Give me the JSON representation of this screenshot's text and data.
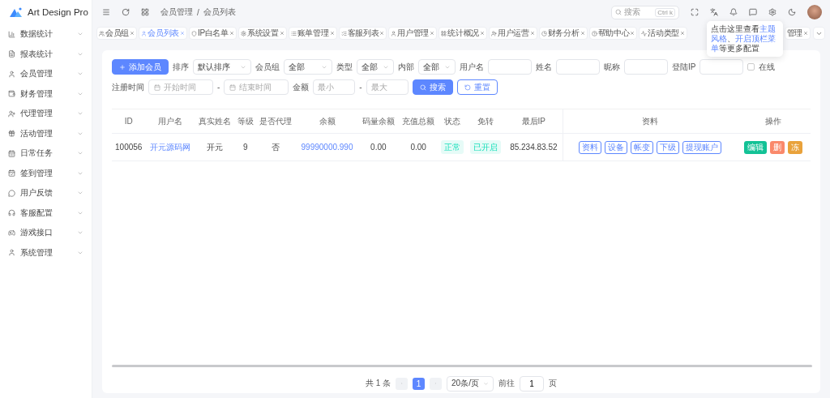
{
  "logo": {
    "title": "Art Design Pro"
  },
  "sidebar": {
    "items": [
      {
        "label": "数据统计"
      },
      {
        "label": "报表统计"
      },
      {
        "label": "会员管理"
      },
      {
        "label": "财务管理"
      },
      {
        "label": "代理管理"
      },
      {
        "label": "活动管理"
      },
      {
        "label": "日常任务"
      },
      {
        "label": "签到管理"
      },
      {
        "label": "用户反馈"
      },
      {
        "label": "客服配置"
      },
      {
        "label": "游戏接口"
      },
      {
        "label": "系统管理"
      }
    ]
  },
  "breadcrumb": {
    "items": [
      "会员管理",
      "会员列表"
    ],
    "separator": "/"
  },
  "search": {
    "placeholder": "搜索",
    "shortcut": "Ctrl k"
  },
  "tabs": [
    {
      "label": "会员组",
      "selected": false
    },
    {
      "label": "会员列表",
      "selected": true
    },
    {
      "label": "IP白名单",
      "selected": false
    },
    {
      "label": "系统设置",
      "selected": false
    },
    {
      "label": "账单管理",
      "selected": false
    },
    {
      "label": "客服列表",
      "selected": false
    },
    {
      "label": "用户管理",
      "selected": false
    },
    {
      "label": "统计概况",
      "selected": false
    },
    {
      "label": "用户运营",
      "selected": false
    },
    {
      "label": "财务分析",
      "selected": false
    },
    {
      "label": "帮助中心",
      "selected": false
    },
    {
      "label": "活动类型",
      "selected": false
    },
    {
      "label": "管理",
      "selected": false
    }
  ],
  "tooltip": {
    "text": "点击这里查看**主题风格**、**开启顶栏菜单**等更多配置"
  },
  "filters": {
    "add_button": "添加会员",
    "row1": [
      {
        "label": "排序",
        "kind": "select",
        "value": "默认排序"
      },
      {
        "label": "会员组",
        "kind": "select",
        "value": "全部"
      },
      {
        "label": "类型",
        "kind": "select",
        "value": "全部"
      },
      {
        "label": "内部",
        "kind": "select",
        "value": "全部"
      },
      {
        "label": "用户名",
        "kind": "input"
      },
      {
        "label": "姓名",
        "kind": "input"
      },
      {
        "label": "昵称",
        "kind": "input"
      },
      {
        "label": "登陆IP",
        "kind": "input"
      }
    ],
    "online": {
      "label": "在线",
      "checked": false
    },
    "register_time": {
      "label": "注册时间",
      "start": "开始时间",
      "dash": "-",
      "end": "结束时间"
    },
    "amount": {
      "label": "金额",
      "min_placeholder": "最小",
      "dash": "-",
      "max_placeholder": "最大"
    },
    "search_button": "搜索",
    "reset_button": "重置"
  },
  "table": {
    "columns": [
      "ID",
      "用户名",
      "真实姓名",
      "等级",
      "是否代理",
      "余额",
      "码量余额",
      "充值总额",
      "状态",
      "免转",
      "最后IP",
      "资料",
      "操作"
    ],
    "rows": [
      {
        "id": "100056",
        "username": "开元源码网",
        "real_name": "开元",
        "level_text": "9",
        "agent": "否",
        "balance": "99990000.990",
        "code_balance": "0.00",
        "recharge_total": "0.00",
        "status": "正常",
        "free_transfer": "已开启",
        "last_ip": "85.234.83.52",
        "data_buttons": [
          "资料",
          "设备",
          "帐变",
          "下级",
          "提现账户"
        ],
        "actions": [
          {
            "label": "编辑",
            "kind": "edit"
          },
          {
            "label": "删",
            "kind": "delete"
          },
          {
            "label": "冻",
            "kind": "warn"
          }
        ]
      }
    ]
  },
  "pagination": {
    "total": "共 1 条",
    "pages": [
      {
        "label": "1",
        "selected": true
      }
    ],
    "page_size": "20条/页",
    "goto_label": "前往",
    "goto_value": "1",
    "page_suffix": "页"
  }
}
